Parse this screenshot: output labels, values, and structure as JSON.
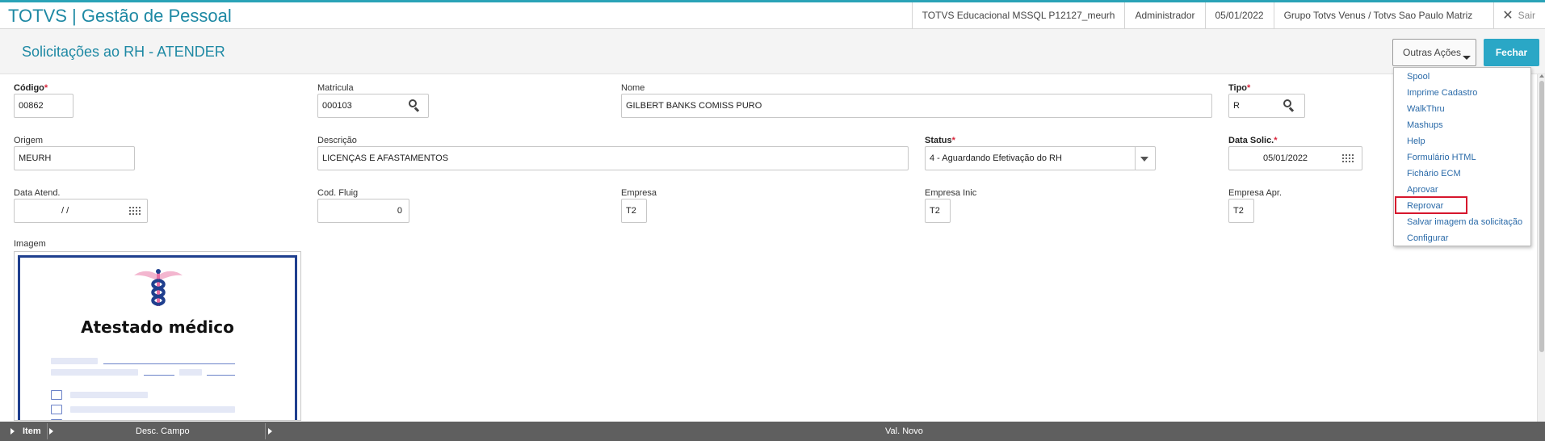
{
  "app": {
    "title": "TOTVS | Gestão de Pessoal",
    "environment": "TOTVS Educacional MSSQL P12127_meurh",
    "user": "Administrador",
    "date": "05/01/2022",
    "company": "Grupo Totvs Venus / Totvs Sao Paulo Matriz",
    "exit_label": "Sair"
  },
  "page": {
    "title": "Solicitações ao RH - ATENDER"
  },
  "actions": {
    "outras_label": "Outras Ações",
    "fechar_label": "Fechar"
  },
  "form": {
    "codigo": {
      "label": "Código",
      "value": "00862"
    },
    "matricula": {
      "label": "Matricula",
      "value": "000103"
    },
    "nome": {
      "label": "Nome",
      "value": "GILBERT BANKS COMISS PURO"
    },
    "tipo": {
      "label": "Tipo",
      "value": "R"
    },
    "origem": {
      "label": "Origem",
      "value": "MEURH"
    },
    "descricao": {
      "label": "Descrição",
      "value": "LICENÇAS E AFASTAMENTOS"
    },
    "status": {
      "label": "Status",
      "value": "4 - Aguardando Efetivação do RH"
    },
    "data_solic": {
      "label": "Data Solic.",
      "value": "05/01/2022"
    },
    "data_atend": {
      "label": "Data Atend.",
      "value": " / /"
    },
    "cod_fluig": {
      "label": "Cod. Fluig",
      "value": "0"
    },
    "empresa": {
      "label": "Empresa",
      "value": "T2"
    },
    "empresa_inic": {
      "label": "Empresa Inic",
      "value": "T2"
    },
    "empresa_apr": {
      "label": "Empresa Apr.",
      "value": "T2"
    },
    "imagem": {
      "label": "Imagem",
      "doc_title": "Atestado médico"
    }
  },
  "menu": {
    "items": [
      "Spool",
      "Imprime Cadastro",
      "WalkThru",
      "Mashups",
      "Help",
      "Formulário HTML",
      "Fichário ECM",
      "Aprovar",
      "Reprovar",
      "Salvar imagem da solicitação",
      "Configurar"
    ],
    "highlighted_index": 8,
    "highlight_color": "#d6162d"
  },
  "grid": {
    "columns": [
      "Item",
      "Desc. Campo",
      "Val. Novo"
    ]
  },
  "colors": {
    "accent": "#1e89a4",
    "button": "#2aa7c6",
    "required": "#d9253b"
  }
}
